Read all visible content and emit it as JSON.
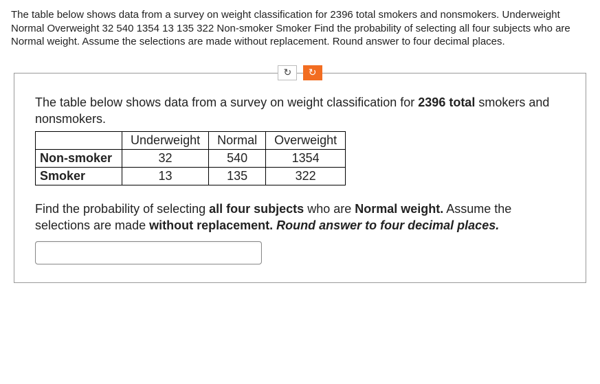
{
  "header": {
    "text": "The table below shows data from a survey on weight classification for 2396 total smokers and nonsmokers. Underweight Normal Overweight 32 540 1354 13 135 322 Non-smoker Smoker Find the probability of selecting all four subjects who are Normal weight. Assume the selections are made without replacement. Round answer to four decimal places."
  },
  "controls": {
    "reset_icon": "↻",
    "submit_icon": "↻"
  },
  "intro": {
    "prefix": "The table below shows data from a survey on weight classification for ",
    "total_bold": "2396 total",
    "suffix": " smokers and nonsmokers."
  },
  "chart_data": {
    "type": "table",
    "columns": [
      "Underweight",
      "Normal",
      "Overweight"
    ],
    "rows": [
      {
        "label": "Non-smoker",
        "values": [
          32,
          540,
          1354
        ]
      },
      {
        "label": "Smoker",
        "values": [
          13,
          135,
          322
        ]
      }
    ],
    "total": 2396
  },
  "question": {
    "p1": "Find the probability of selecting ",
    "b1": "all four subjects",
    "p2": " who are ",
    "b2": "Normal weight.",
    "p3": " Assume the selections are made ",
    "b3": "without replacement.",
    "p4": " ",
    "i1": "Round answer to four decimal places."
  },
  "answer": {
    "value": "",
    "placeholder": ""
  }
}
